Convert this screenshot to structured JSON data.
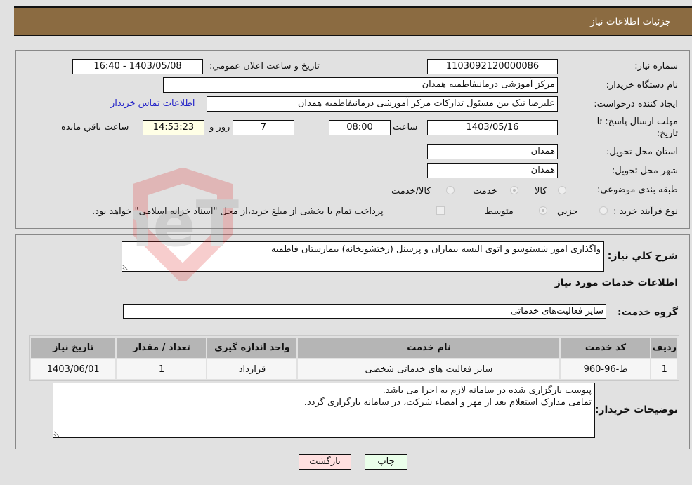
{
  "header": {
    "title": "جزئیات اطلاعات نیاز"
  },
  "details": {
    "need_number_label": "شماره نیاز:",
    "need_number": "1103092120000086",
    "announce_label": "تاریخ و ساعت اعلان عمومي:",
    "announce_value": "1403/05/08 - 16:40",
    "buyer_org_label": "نام دستگاه خریدار:",
    "buyer_org": "مرکز آموزشی درمانیفاطمیه همدان",
    "requester_label": "ایجاد کننده درخواست:",
    "requester": "علیرضا نیک بین مسئول تدارکات مرکز آموزشی درمانیفاطمیه همدان",
    "buyer_contact_link": "اطلاعات تماس خریدار",
    "deadline_label": "مهلت ارسال پاسخ: تا تاریخ:",
    "deadline_date": "1403/05/16",
    "time_label": "ساعت",
    "deadline_time": "08:00",
    "days_value": "7",
    "days_label": "روز و",
    "remaining_time": "14:53:23",
    "remaining_label": "ساعت باقي مانده",
    "province_label": "استان محل تحویل:",
    "province": "همدان",
    "city_label": "شهر محل تحویل:",
    "city": "همدان",
    "category_label": "طبقه بندی موضوعی:",
    "category_options": [
      {
        "label": "کالا",
        "selected": false
      },
      {
        "label": "خدمت",
        "selected": true
      },
      {
        "label": "کالا/خدمت",
        "selected": false
      }
    ],
    "process_label": "نوع فرآیند خرید :",
    "process_options": [
      {
        "label": "جزیي",
        "selected": false
      },
      {
        "label": "متوسط",
        "selected": true
      }
    ],
    "treasury_note": "پرداخت تمام یا بخشی از مبلغ خرید،از محل \"اسناد خزانه اسلامی\" خواهد بود.",
    "treasury_checked": false
  },
  "services": {
    "summary_label": "شرح كلي نياز:",
    "summary": "واگذاری امور شستوشو و اتوی البسه بیماران و پرسنل (رختشویخانه) بیمارستان فاطمیه",
    "section_title": "اطلاعات خدمات مورد نیاز",
    "group_label": "گروه خدمت:",
    "group": "سایر فعالیت‌های خدماتی",
    "table": {
      "headers": [
        "ردیف",
        "کد خدمت",
        "نام خدمت",
        "واحد اندازه گیری",
        "تعداد / مقدار",
        "تاریخ نیاز"
      ],
      "rows": [
        [
          "1",
          "ط-96-960",
          "سایر فعالیت های خدماتی شخصی",
          "قرارداد",
          "1",
          "1403/06/01"
        ]
      ]
    },
    "buyer_notes_label": "توضیحات خریدار:",
    "buyer_notes": "پیوست بارگزاری شده در سامانه لازم به اجرا می باشد.\nتمامی مدارک استعلام بعد از مهر و امضاء شرکت، در سامانه بارگزاری گردد."
  },
  "buttons": {
    "print": "چاپ",
    "back": "بازگشت"
  },
  "watermark": "AriaTender.neT",
  "colors": {
    "header_bg": "#8b6b41",
    "print_bg": "#eaffea",
    "back_bg": "#ffe0e0",
    "link": "#2323c8"
  }
}
